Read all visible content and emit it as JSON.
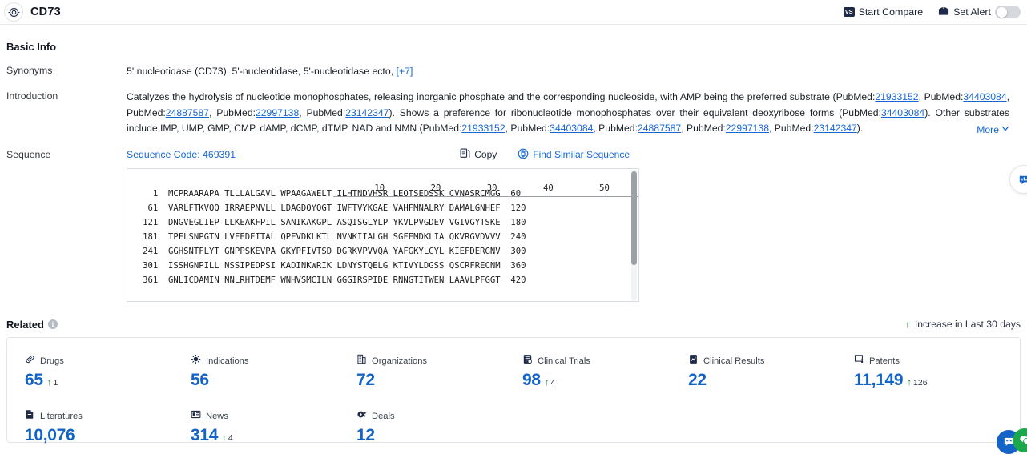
{
  "header": {
    "title": "CD73",
    "logo_icon": "target-icon",
    "actions": [
      {
        "label": "Start Compare",
        "icon": "vs-badge-icon",
        "badge_text": "VS"
      },
      {
        "label": "Set Alert",
        "icon": "alert-mail-icon",
        "toggle_state": "off"
      }
    ]
  },
  "basic_info": {
    "section_title": "Basic Info",
    "synonyms": {
      "label": "Synonyms",
      "value": "5' nucleotidase (CD73),  5'-nucleotidase,  5'-nucleotidase ecto,",
      "more_link": "[+7]"
    },
    "introduction": {
      "label": "Introduction",
      "more_label": "More",
      "text_parts": [
        {
          "t": "Catalyzes the hydrolysis of nucleotide monophosphates, releasing inorganic phosphate and the corresponding nucleoside, with AMP being the preferred substrate (PubMed:"
        },
        {
          "link": "21933152"
        },
        {
          "t": ", PubMed:"
        },
        {
          "link": "34403084"
        },
        {
          "t": ", PubMed:"
        },
        {
          "link": "24887587"
        },
        {
          "t": ", PubMed:"
        },
        {
          "link": "22997138"
        },
        {
          "t": ", PubMed:"
        },
        {
          "link": "23142347"
        },
        {
          "t": "). Shows a preference for ribonucleotide monophosphates over their equivalent deoxyribose forms (PubMed:"
        },
        {
          "link": "34403084"
        },
        {
          "t": "). Other substrates include IMP, UMP, GMP, CMP, dAMP, dCMP, dTMP, NAD and NMN (PubMed:"
        },
        {
          "link": "21933152"
        },
        {
          "t": ", PubMed:"
        },
        {
          "link": "34403084"
        },
        {
          "t": ", PubMed:"
        },
        {
          "link": "24887587"
        },
        {
          "t": ", PubMed:"
        },
        {
          "link": "22997138"
        },
        {
          "t": ", PubMed:"
        },
        {
          "link": "23142347"
        },
        {
          "t": ")."
        }
      ]
    },
    "sequence": {
      "label": "Sequence",
      "code_label": "Sequence Code: 469391",
      "copy_label": "Copy",
      "copy_icon": "copy-icon",
      "find_similar_label": "Find Similar Sequence",
      "find_similar_icon": "find-similar-icon",
      "ruler_ticks": [
        "10",
        "20",
        "30",
        "40",
        "50"
      ],
      "rows": [
        {
          "start": "1",
          "blocks": [
            "MCPRAARAPA",
            "TLLLALGAVL",
            "WPAAGAWELT",
            "ILHTNDVHSR",
            "LEQTSEDSSK",
            "CVNASRCMGG"
          ],
          "end": "60"
        },
        {
          "start": "61",
          "blocks": [
            "VARLFTKVQQ",
            "IRRAEPNVLL",
            "LDAGDQYQGT",
            "IWFTVYKGAE",
            "VAHFMNALRY",
            "DAMALGNHEF"
          ],
          "end": "120"
        },
        {
          "start": "121",
          "blocks": [
            "DNGVEGLIEP",
            "LLKEAKFPIL",
            "SANIKAKGPL",
            "ASQISGLYLP",
            "YKVLPVGDEV",
            "VGIVGYTSKE"
          ],
          "end": "180"
        },
        {
          "start": "181",
          "blocks": [
            "TPFLSNPGTN",
            "LVFEDEITAL",
            "QPEVDKLKTL",
            "NVNKIIALGH",
            "SGFEMDKLIA",
            "QKVRGVDVVV"
          ],
          "end": "240"
        },
        {
          "start": "241",
          "blocks": [
            "GGHSNTFLYT",
            "GNPPSKEVPA",
            "GKYPFIVTSD",
            "DGRKVPVVQA",
            "YAFGKYLGYL",
            "KIEFDERGNV"
          ],
          "end": "300"
        },
        {
          "start": "301",
          "blocks": [
            "ISSHGNPILL",
            "NSSIPEDPSI",
            "KADINKWRIK",
            "LDNYSTQELG",
            "KTIVYLDGSS",
            "QSCRFRECNM"
          ],
          "end": "360"
        },
        {
          "start": "361",
          "blocks": [
            "GNLICDAMIN",
            "NNLRHTDEMF",
            "WNHVSMCILN",
            "GGGIRSPIDE",
            "RNNGTITWEN",
            "LAAVLPFGGT"
          ],
          "end": "420"
        }
      ]
    }
  },
  "related": {
    "title": "Related",
    "info_icon": "info-icon",
    "legend": "Increase in Last 30 days",
    "legend_icon": "up-arrow-icon",
    "stats": [
      {
        "label": "Drugs",
        "icon": "pill-icon",
        "value": "65",
        "delta": "1"
      },
      {
        "label": "Indications",
        "icon": "virus-icon",
        "value": "56",
        "delta": ""
      },
      {
        "label": "Organizations",
        "icon": "building-icon",
        "value": "72",
        "delta": ""
      },
      {
        "label": "Clinical Trials",
        "icon": "clinical-trial-icon",
        "value": "98",
        "delta": "4"
      },
      {
        "label": "Clinical Results",
        "icon": "clinical-result-icon",
        "value": "22",
        "delta": ""
      },
      {
        "label": "Patents",
        "icon": "patent-icon",
        "value": "11,149",
        "delta": "126"
      },
      {
        "label": "Literatures",
        "icon": "literature-icon",
        "value": "10,076",
        "delta": ""
      },
      {
        "label": "News",
        "icon": "news-icon",
        "value": "314",
        "delta": "4"
      },
      {
        "label": "Deals",
        "icon": "deal-icon",
        "value": "12",
        "delta": ""
      }
    ]
  },
  "floating": {
    "mid_icon": "feedback-icon",
    "fab_primary_icon": "chat-icon",
    "fab_secondary_icon": "wechat-icon"
  },
  "colors": {
    "accent_blue": "#1463c6",
    "link_blue": "#1667d4",
    "increase_green": "#1f8a3c",
    "border": "#e2e6eb"
  }
}
